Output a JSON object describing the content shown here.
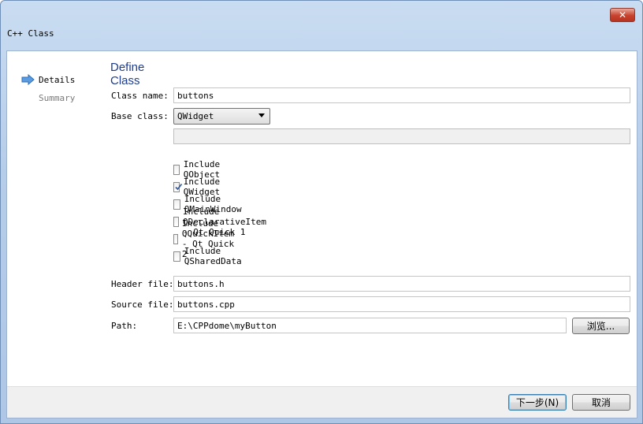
{
  "window": {
    "title": "C++ Class",
    "close_symbol": "✕"
  },
  "sidebar": {
    "items": [
      {
        "label": "Details",
        "active": true
      },
      {
        "label": "Summary",
        "active": false
      }
    ]
  },
  "form": {
    "heading": "Define Class",
    "class_name": {
      "label": "Class name:",
      "value": "buttons"
    },
    "base_class": {
      "label": "Base class:",
      "value": "QWidget",
      "extra_value": ""
    },
    "checkboxes": [
      {
        "label": "Include QObject",
        "checked": false
      },
      {
        "label": "Include QWidget",
        "checked": true
      },
      {
        "label": "Include QMainWindow",
        "checked": false
      },
      {
        "label": "Include QDeclarativeItem - Qt Quick 1",
        "checked": false
      },
      {
        "label": "Include QQuickItem - Qt Quick 2",
        "checked": false
      },
      {
        "label": "Include QSharedData",
        "checked": false
      }
    ],
    "header_file": {
      "label": "Header file:",
      "value": "buttons.h"
    },
    "source_file": {
      "label": "Source file:",
      "value": "buttons.cpp"
    },
    "path": {
      "label": "Path:",
      "value": "E:\\CPPdome\\myButton",
      "browse_label": "浏览..."
    }
  },
  "footer": {
    "next_label": "下一步(N)",
    "cancel_label": "取消"
  },
  "colors": {
    "heading": "#1f3d8a",
    "arrow": "#5b9be0",
    "sidebar_inactive": "#7a7a7a"
  }
}
